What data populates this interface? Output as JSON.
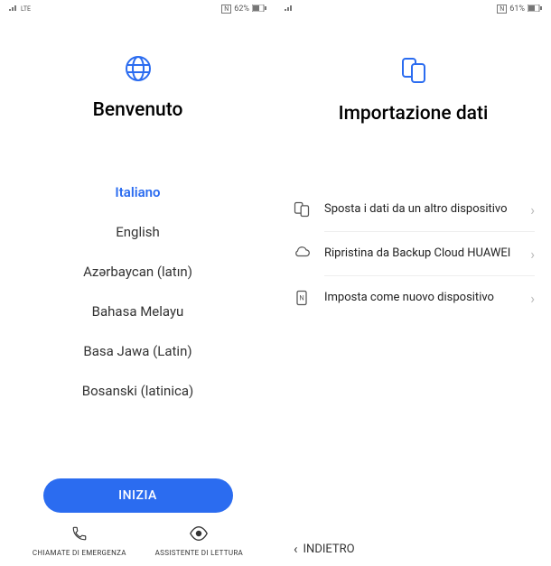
{
  "left": {
    "status": {
      "network": "LTE",
      "nfc": "N",
      "battery": "62%"
    },
    "title": "Benvenuto",
    "languages": [
      {
        "label": "Italiano",
        "selected": true
      },
      {
        "label": "English",
        "selected": false
      },
      {
        "label": "Azərbaycan (latın)",
        "selected": false
      },
      {
        "label": "Bahasa Melayu",
        "selected": false
      },
      {
        "label": "Basa Jawa (Latin)",
        "selected": false
      },
      {
        "label": "Bosanski (latinica)",
        "selected": false
      }
    ],
    "primary_button": "INIZIA",
    "bottom": {
      "emergency": "CHIAMATE DI EMERGENZA",
      "reader": "ASSISTENTE DI LETTURA"
    }
  },
  "right": {
    "status": {
      "nfc": "N",
      "battery": "61%"
    },
    "title": "Importazione dati",
    "options": [
      {
        "label": "Sposta i dati da un altro dispositivo"
      },
      {
        "label": "Ripristina da Backup Cloud HUAWEI"
      },
      {
        "label": "Imposta come nuovo dispositivo"
      }
    ],
    "back": "INDIETRO"
  },
  "colors": {
    "accent": "#2b6cf0"
  }
}
